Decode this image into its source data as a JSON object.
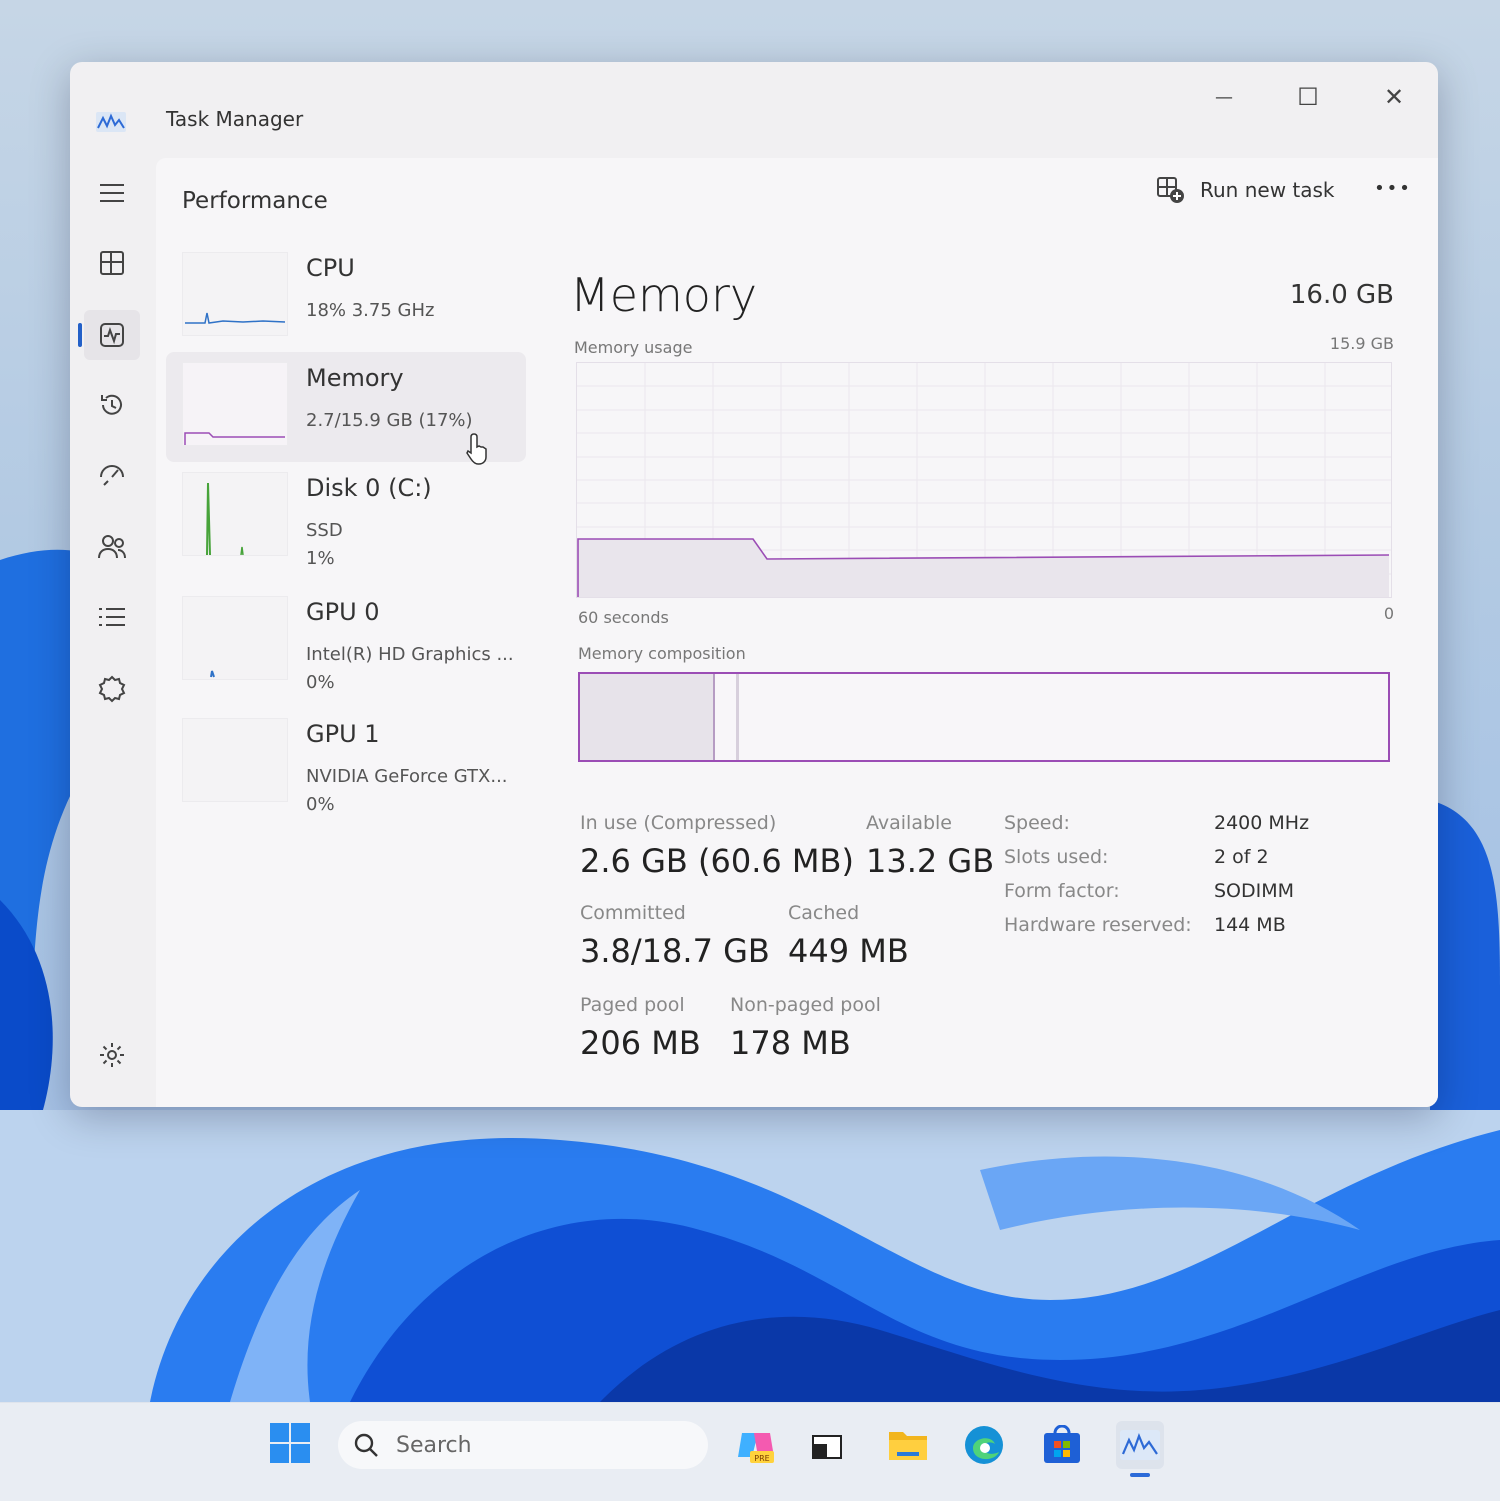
{
  "window": {
    "title": "Task Manager",
    "controls": {
      "minimize": "—",
      "maximize": "☐",
      "close": "✕"
    }
  },
  "nav": {
    "items": [
      {
        "icon": "hamburger-menu-icon"
      },
      {
        "icon": "processes-icon"
      },
      {
        "icon": "performance-icon",
        "active": true
      },
      {
        "icon": "app-history-icon"
      },
      {
        "icon": "startup-apps-icon"
      },
      {
        "icon": "users-icon"
      },
      {
        "icon": "details-icon"
      },
      {
        "icon": "services-icon"
      },
      {
        "icon": "settings-icon"
      }
    ]
  },
  "header": {
    "page_title": "Performance",
    "run_new_task": "Run new task",
    "more": "•••"
  },
  "devices": [
    {
      "name": "CPU",
      "line1": "18%  3.75 GHz",
      "line2": ""
    },
    {
      "name": "Memory",
      "line1": "2.7/15.9 GB (17%)",
      "line2": "",
      "selected": true
    },
    {
      "name": "Disk 0 (C:)",
      "line1": "SSD",
      "line2": "1%"
    },
    {
      "name": "GPU 0",
      "line1": "Intel(R) HD Graphics ...",
      "line2": "0%"
    },
    {
      "name": "GPU 1",
      "line1": "NVIDIA GeForce GTX...",
      "line2": "0%"
    }
  ],
  "detail": {
    "title": "Memory",
    "total": "16.0 GB",
    "usage_label": "Memory usage",
    "usage_max": "15.9 GB",
    "axis_left": "60 seconds",
    "axis_right": "0",
    "composition_label": "Memory composition",
    "composition_in_use_fraction": 0.165,
    "stats": {
      "in_use_label": "In use (Compressed)",
      "in_use_value": "2.6 GB (60.6 MB)",
      "available_label": "Available",
      "available_value": "13.2 GB",
      "committed_label": "Committed",
      "committed_value": "3.8/18.7 GB",
      "cached_label": "Cached",
      "cached_value": "449 MB",
      "paged_label": "Paged pool",
      "paged_value": "206 MB",
      "nonpaged_label": "Non-paged pool",
      "nonpaged_value": "178 MB"
    },
    "specs": [
      {
        "key": "Speed:",
        "value": "2400 MHz"
      },
      {
        "key": "Slots used:",
        "value": "2 of 2"
      },
      {
        "key": "Form factor:",
        "value": "SODIMM"
      },
      {
        "key": "Hardware reserved:",
        "value": "144 MB"
      }
    ]
  },
  "taskbar": {
    "search_placeholder": "Search",
    "copilot_badge": "PRE",
    "apps": [
      "copilot-icon",
      "task-view-icon",
      "file-explorer-icon",
      "edge-icon",
      "store-icon",
      "task-manager-icon"
    ]
  },
  "colors": {
    "memory_accent": "#9b4db5",
    "active_indicator": "#2360c8"
  }
}
